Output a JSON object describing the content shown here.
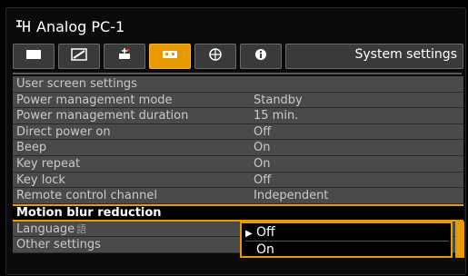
{
  "header": {
    "source_icon": "projector-input-icon",
    "title": "Analog PC-1",
    "section": "System settings"
  },
  "tabs": [
    {
      "icon": "picture-icon",
      "name": "Image adjustment",
      "active": false
    },
    {
      "icon": "image-adjust-icon",
      "name": "Advanced image adjustment",
      "active": false
    },
    {
      "icon": "installation-icon",
      "name": "Install settings",
      "active": false
    },
    {
      "icon": "system-settings-icon",
      "name": "System settings",
      "active": true
    },
    {
      "icon": "network-icon",
      "name": "Network settings",
      "active": false
    },
    {
      "icon": "info-icon",
      "name": "Information",
      "active": false
    }
  ],
  "menu": [
    {
      "label": "User screen settings",
      "value": ""
    },
    {
      "label": "Power management mode",
      "value": "Standby"
    },
    {
      "label": "Power management duration",
      "value": "15 min."
    },
    {
      "label": "Direct power on",
      "value": "Off"
    },
    {
      "label": "Beep",
      "value": "On"
    },
    {
      "label": "Key repeat",
      "value": "On"
    },
    {
      "label": "Key lock",
      "value": "Off"
    },
    {
      "label": "Remote control channel",
      "value": "Independent"
    },
    {
      "label": "Motion blur reduction",
      "value": ""
    },
    {
      "label": "Language",
      "value": ""
    },
    {
      "label": "Other settings",
      "value": ""
    }
  ],
  "popup": {
    "selected": "Off",
    "other": "On"
  },
  "colors": {
    "accent": "#e89b00",
    "row_bg": "#4a4a4a",
    "text_dim": "#c9c9c9"
  }
}
